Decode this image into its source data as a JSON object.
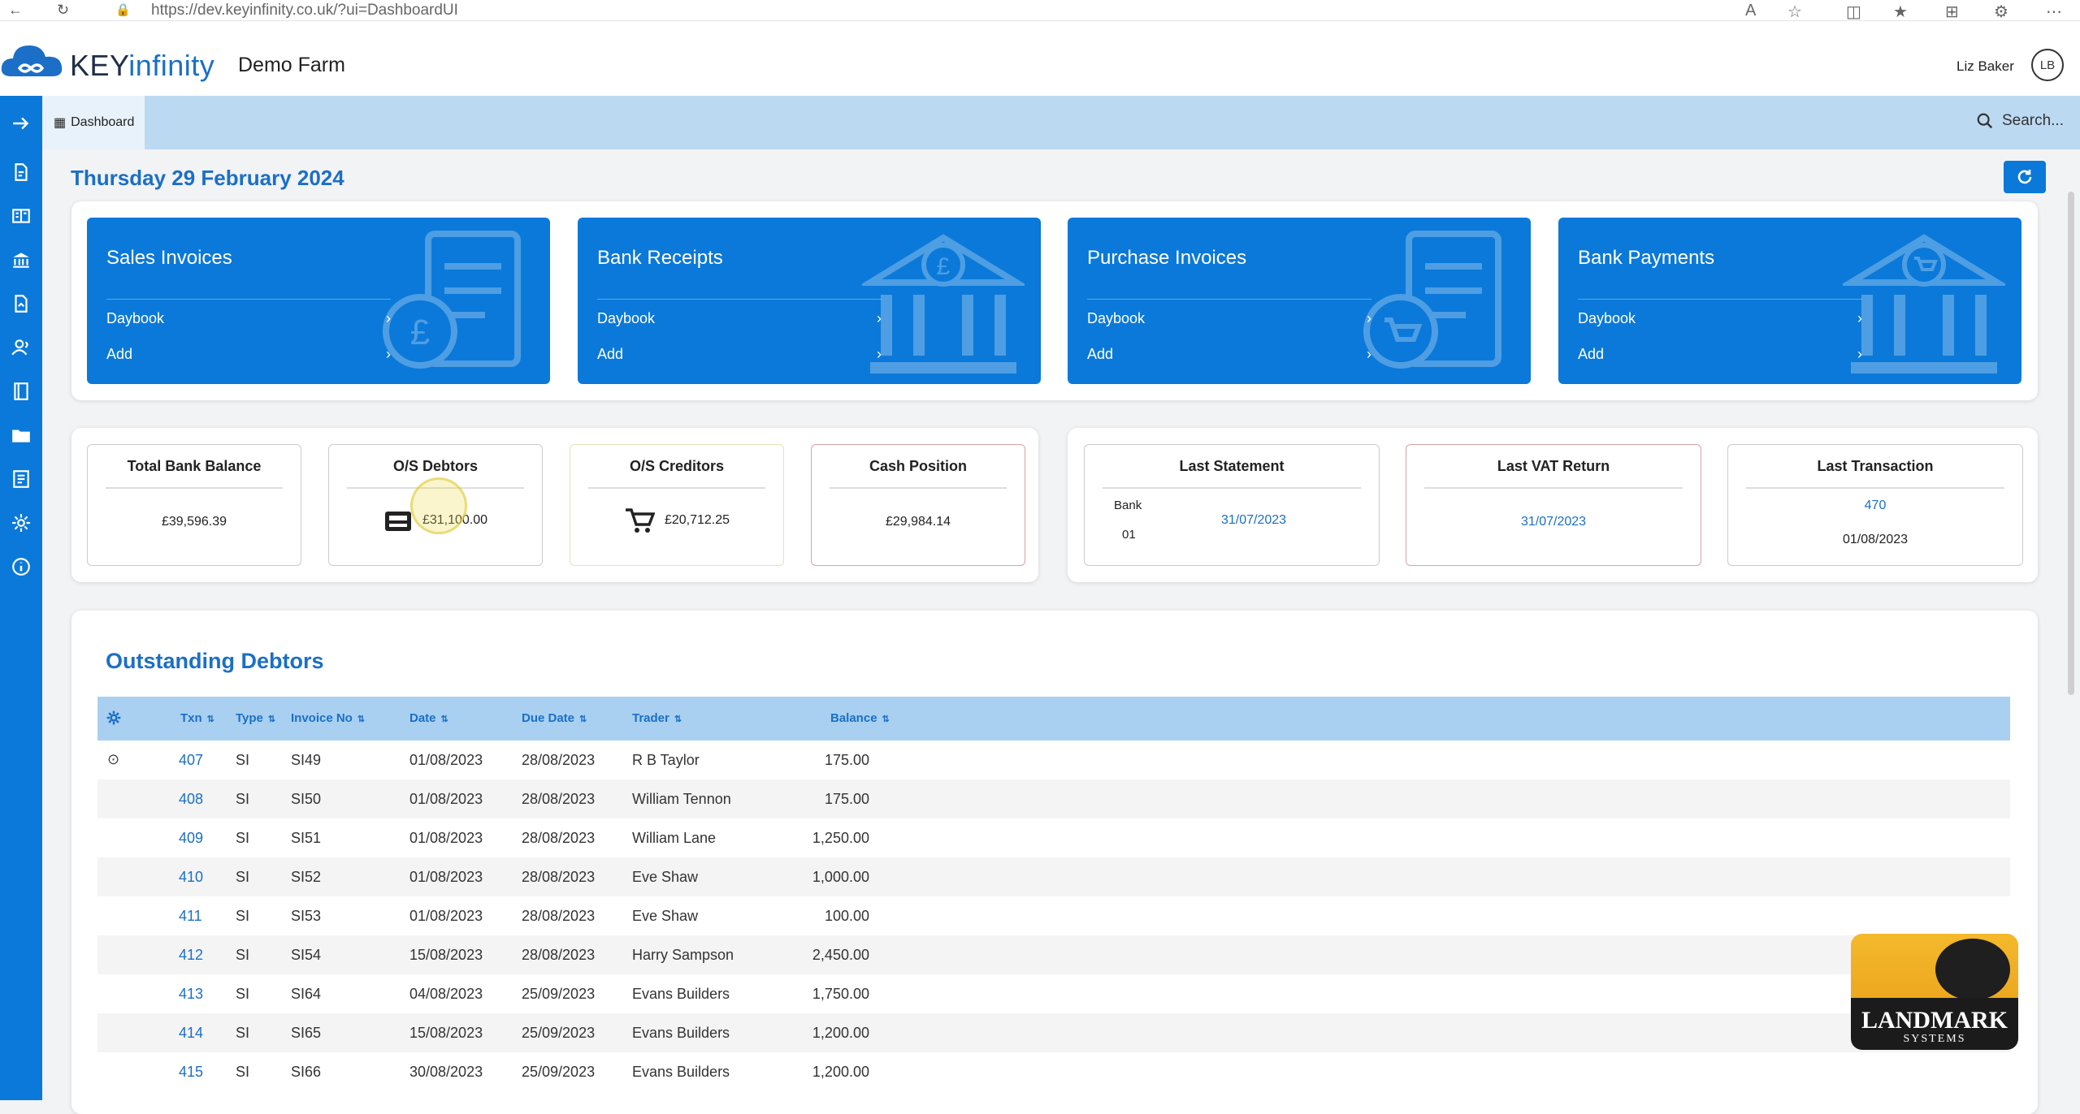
{
  "browser": {
    "url": "https://dev.keyinfinity.co.uk/?ui=DashboardUI"
  },
  "header": {
    "logo_key": "KEY",
    "logo_infinity": "infinity",
    "farm": "Demo Farm",
    "user_name": "Liz Baker",
    "user_initials": "LB"
  },
  "tabs": {
    "dashboard": "Dashboard",
    "search_placeholder": "Search..."
  },
  "main": {
    "date": "Thursday 29 February 2024"
  },
  "cards": [
    {
      "title": "Sales Invoices",
      "link1": "Daybook",
      "link2": "Add",
      "icon": "invoice-pound-icon"
    },
    {
      "title": "Bank Receipts",
      "link1": "Daybook",
      "link2": "Add",
      "icon": "bank-pound-icon"
    },
    {
      "title": "Purchase Invoices",
      "link1": "Daybook",
      "link2": "Add",
      "icon": "invoice-cart-icon"
    },
    {
      "title": "Bank Payments",
      "link1": "Daybook",
      "link2": "Add",
      "icon": "bank-cart-icon"
    }
  ],
  "stats": {
    "total_bank_balance": {
      "title": "Total Bank Balance",
      "value": "£39,596.39"
    },
    "os_debtors": {
      "title": "O/S Debtors",
      "value": "£31,100.00"
    },
    "os_creditors": {
      "title": "O/S Creditors",
      "value": "£20,712.25"
    },
    "cash_position": {
      "title": "Cash Position",
      "value": "£29,984.14"
    },
    "last_statement": {
      "title": "Last Statement",
      "bank_label": "Bank",
      "bank_no": "01",
      "date": "31/07/2023"
    },
    "last_vat_return": {
      "title": "Last VAT Return",
      "date": "31/07/2023"
    },
    "last_transaction": {
      "title": "Last Transaction",
      "txn": "470",
      "date": "01/08/2023"
    }
  },
  "debtors": {
    "title": "Outstanding Debtors",
    "columns": [
      "Txn",
      "Type",
      "Invoice No",
      "Date",
      "Due Date",
      "Trader",
      "Balance"
    ],
    "rows": [
      {
        "txn": "407",
        "type": "SI",
        "invoice": "SI49",
        "date": "01/08/2023",
        "due": "28/08/2023",
        "trader": "R B Taylor",
        "balance": "175.00"
      },
      {
        "txn": "408",
        "type": "SI",
        "invoice": "SI50",
        "date": "01/08/2023",
        "due": "28/08/2023",
        "trader": "William Tennon",
        "balance": "175.00"
      },
      {
        "txn": "409",
        "type": "SI",
        "invoice": "SI51",
        "date": "01/08/2023",
        "due": "28/08/2023",
        "trader": "William Lane",
        "balance": "1,250.00"
      },
      {
        "txn": "410",
        "type": "SI",
        "invoice": "SI52",
        "date": "01/08/2023",
        "due": "28/08/2023",
        "trader": "Eve Shaw",
        "balance": "1,000.00"
      },
      {
        "txn": "411",
        "type": "SI",
        "invoice": "SI53",
        "date": "01/08/2023",
        "due": "28/08/2023",
        "trader": "Eve Shaw",
        "balance": "100.00"
      },
      {
        "txn": "412",
        "type": "SI",
        "invoice": "SI54",
        "date": "15/08/2023",
        "due": "28/08/2023",
        "trader": "Harry Sampson",
        "balance": "2,450.00"
      },
      {
        "txn": "413",
        "type": "SI",
        "invoice": "SI64",
        "date": "04/08/2023",
        "due": "25/09/2023",
        "trader": "Evans Builders",
        "balance": "1,750.00"
      },
      {
        "txn": "414",
        "type": "SI",
        "invoice": "SI65",
        "date": "15/08/2023",
        "due": "25/09/2023",
        "trader": "Evans Builders",
        "balance": "1,200.00"
      },
      {
        "txn": "415",
        "type": "SI",
        "invoice": "SI66",
        "date": "30/08/2023",
        "due": "25/09/2023",
        "trader": "Evans Builders",
        "balance": "1,200.00"
      }
    ]
  },
  "badge": {
    "line1": "LANDMARK",
    "line2": "SYSTEMS"
  },
  "colors": {
    "accent": "#0b79d9",
    "tabbar": "#bcd9f2",
    "link": "#1b6fc6"
  }
}
